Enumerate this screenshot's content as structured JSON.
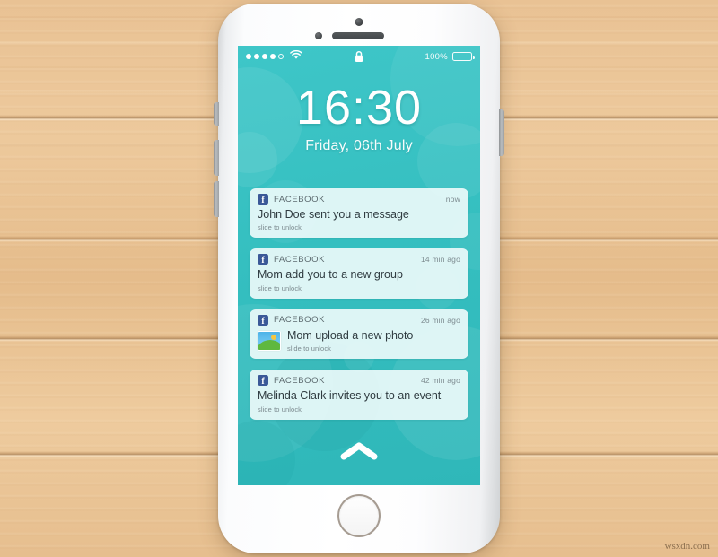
{
  "scene": {
    "background": "wood-planks",
    "wood_color": "#e8c193",
    "watermark": "wsxdn.com"
  },
  "phone": {
    "device": "white-smartphone",
    "hardware": {
      "camera": "front-camera",
      "sensor": "proximity-sensor",
      "speaker": "earpiece-speaker",
      "home_button": "home-button",
      "ringer_switch": "ringer-switch",
      "volume_up": "volume-up-button",
      "volume_down": "volume-down-button",
      "power": "power-button"
    }
  },
  "screen": {
    "accent_color": "#35bfc0",
    "status_bar": {
      "signal_dots_filled": 4,
      "signal_dots_total": 5,
      "wifi_icon": "wifi-icon",
      "lock_icon": "lock-icon",
      "battery_percent": "100%",
      "battery_level": 100
    },
    "lock_screen": {
      "time": "16:30",
      "date": "Friday, 06th July",
      "unlock_hint_icon": "chevron-up-icon"
    },
    "notifications": [
      {
        "app": "FACEBOOK",
        "app_icon": "facebook-icon",
        "time": "now",
        "title": "John Doe sent you a message",
        "subtitle": "slide to unlock",
        "thumbnail": null
      },
      {
        "app": "FACEBOOK",
        "app_icon": "facebook-icon",
        "time": "14 min ago",
        "title": "Mom add you to a new group",
        "subtitle": "slide to unlock",
        "thumbnail": null
      },
      {
        "app": "FACEBOOK",
        "app_icon": "facebook-icon",
        "time": "26 min ago",
        "title": "Mom upload a new photo",
        "subtitle": "slide to unlock",
        "thumbnail": "photo-thumbnail-icon"
      },
      {
        "app": "FACEBOOK",
        "app_icon": "facebook-icon",
        "time": "42 min ago",
        "title": "Melinda Clark invites you to an event",
        "subtitle": "slide to unlock",
        "thumbnail": null
      }
    ]
  }
}
